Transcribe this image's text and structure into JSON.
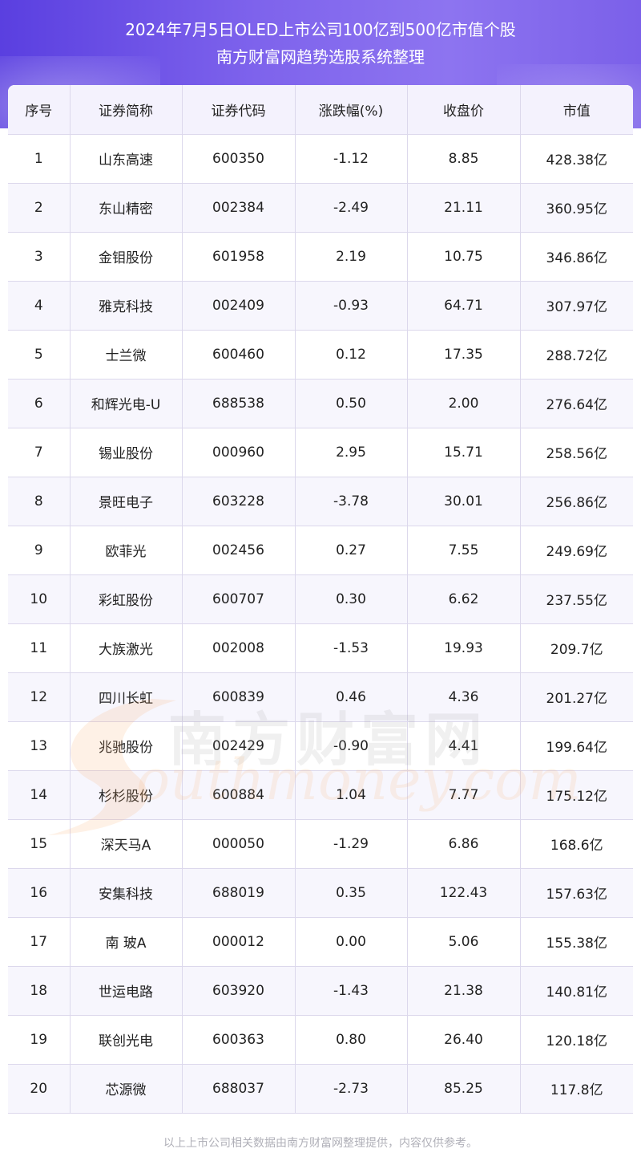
{
  "header": {
    "title_line1": "2024年7月5日OLED上市公司100亿到500亿市值个股",
    "title_line2": "南方财富网趋势选股系统整理"
  },
  "table": {
    "columns": [
      "序号",
      "证券简称",
      "证券代码",
      "涨跌幅(%)",
      "收盘价",
      "市值"
    ],
    "rows": [
      [
        "1",
        "山东高速",
        "600350",
        "-1.12",
        "8.85",
        "428.38亿"
      ],
      [
        "2",
        "东山精密",
        "002384",
        "-2.49",
        "21.11",
        "360.95亿"
      ],
      [
        "3",
        "金钼股份",
        "601958",
        "2.19",
        "10.75",
        "346.86亿"
      ],
      [
        "4",
        "雅克科技",
        "002409",
        "-0.93",
        "64.71",
        "307.97亿"
      ],
      [
        "5",
        "士兰微",
        "600460",
        "0.12",
        "17.35",
        "288.72亿"
      ],
      [
        "6",
        "和辉光电-U",
        "688538",
        "0.50",
        "2.00",
        "276.64亿"
      ],
      [
        "7",
        "锡业股份",
        "000960",
        "2.95",
        "15.71",
        "258.56亿"
      ],
      [
        "8",
        "景旺电子",
        "603228",
        "-3.78",
        "30.01",
        "256.86亿"
      ],
      [
        "9",
        "欧菲光",
        "002456",
        "0.27",
        "7.55",
        "249.69亿"
      ],
      [
        "10",
        "彩虹股份",
        "600707",
        "0.30",
        "6.62",
        "237.55亿"
      ],
      [
        "11",
        "大族激光",
        "002008",
        "-1.53",
        "19.93",
        "209.7亿"
      ],
      [
        "12",
        "四川长虹",
        "600839",
        "0.46",
        "4.36",
        "201.27亿"
      ],
      [
        "13",
        "兆驰股份",
        "002429",
        "-0.90",
        "4.41",
        "199.64亿"
      ],
      [
        "14",
        "杉杉股份",
        "600884",
        "1.04",
        "7.77",
        "175.12亿"
      ],
      [
        "15",
        "深天马A",
        "000050",
        "-1.29",
        "6.86",
        "168.6亿"
      ],
      [
        "16",
        "安集科技",
        "688019",
        "0.35",
        "122.43",
        "157.63亿"
      ],
      [
        "17",
        "南 玻A",
        "000012",
        "0.00",
        "5.06",
        "155.38亿"
      ],
      [
        "18",
        "世运电路",
        "603920",
        "-1.43",
        "21.38",
        "140.81亿"
      ],
      [
        "19",
        "联创光电",
        "600363",
        "0.80",
        "26.40",
        "120.18亿"
      ],
      [
        "20",
        "芯源微",
        "688037",
        "-2.73",
        "85.25",
        "117.8亿"
      ]
    ]
  },
  "watermark": {
    "cn": "南方财富网",
    "en": "outhmoney.com"
  },
  "footer": {
    "note": "以上上市公司相关数据由南方财富网整理提供，内容仅供参考。"
  }
}
